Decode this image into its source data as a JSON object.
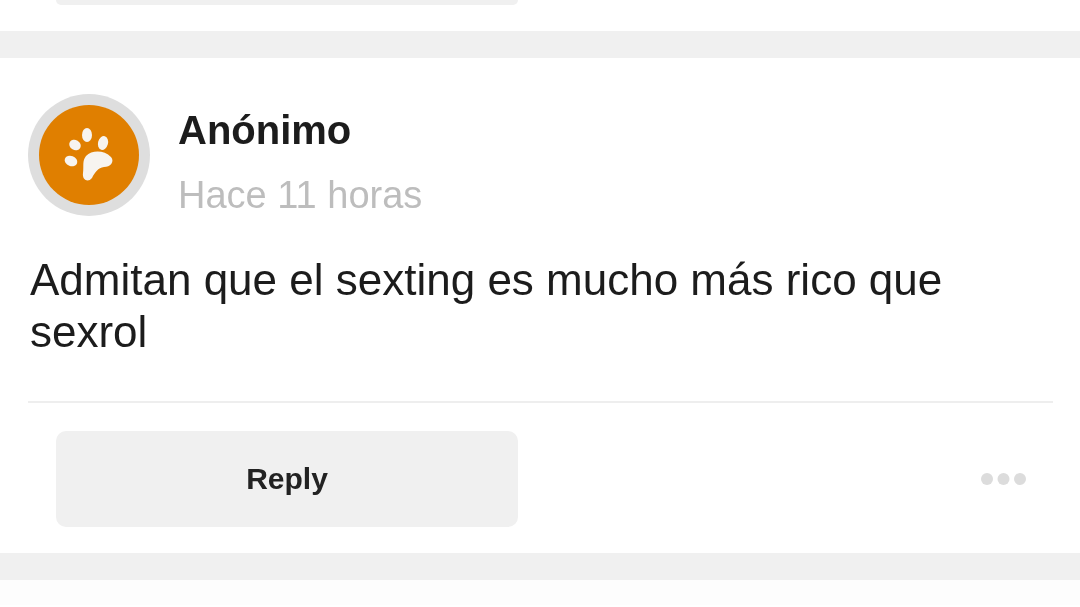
{
  "post": {
    "author": "Anónimo",
    "time": "Hace 11 horas",
    "text": "Admitan que el sexting es mucho más rico que sexrol"
  },
  "actions": {
    "reply": "Reply"
  }
}
